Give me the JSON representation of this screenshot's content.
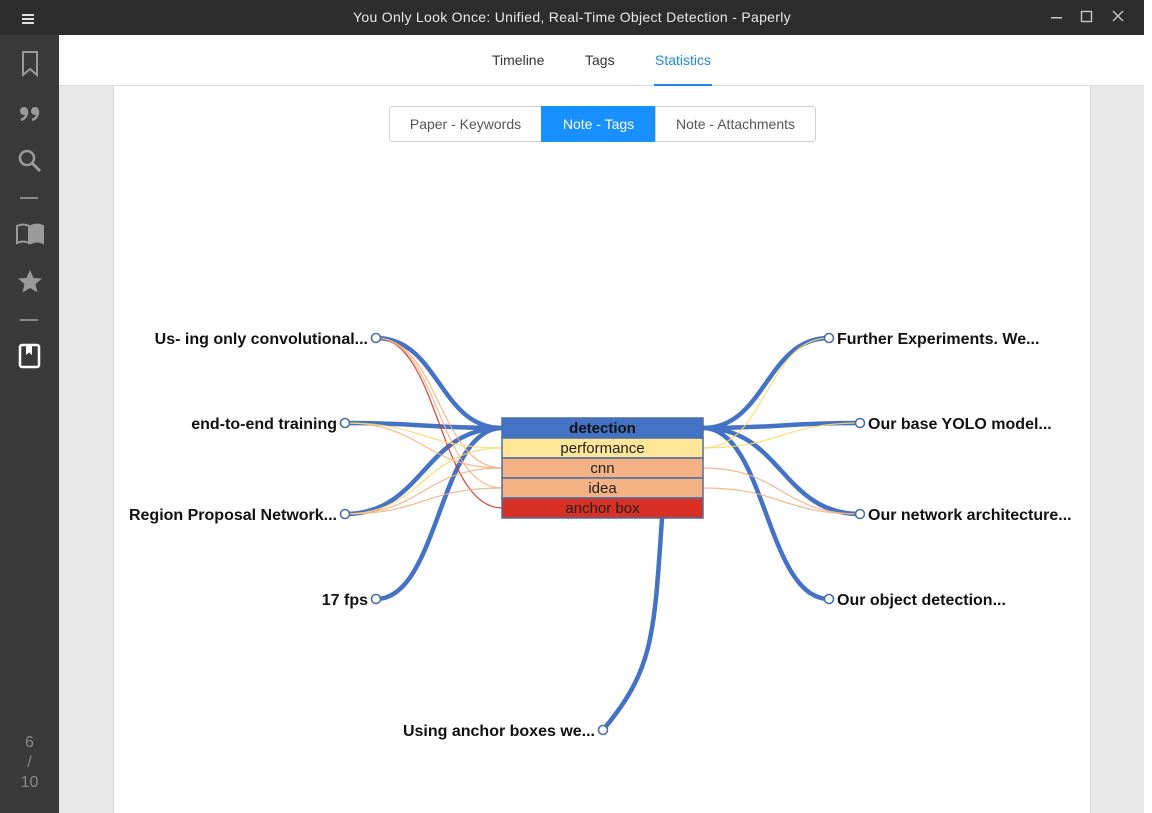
{
  "window": {
    "title": "You Only Look Once: Unified, Real-Time Object Detection - Paperly"
  },
  "sidebar": {
    "items": [
      {
        "name": "bookmark-icon"
      },
      {
        "name": "quote-icon"
      },
      {
        "name": "search-icon"
      },
      {
        "name": "book-open-icon"
      },
      {
        "name": "star-icon"
      },
      {
        "name": "note-icon"
      }
    ],
    "page_current": "6",
    "page_sep": "/",
    "page_total": "10"
  },
  "tabs": [
    {
      "label": "Timeline"
    },
    {
      "label": "Tags"
    },
    {
      "label": "Statistics",
      "active": true
    }
  ],
  "segments": [
    {
      "label": "Paper - Keywords"
    },
    {
      "label": "Note - Tags",
      "active": true
    },
    {
      "label": "Note - Attachments"
    }
  ],
  "chart_data": {
    "type": "bipartite-graph",
    "tags": [
      {
        "label": "detection",
        "color": "#4472c4"
      },
      {
        "label": "performance",
        "color": "#ffe699"
      },
      {
        "label": "cnn",
        "color": "#f4b183"
      },
      {
        "label": "idea",
        "color": "#f4b183"
      },
      {
        "label": "anchor box",
        "color": "#d93025"
      }
    ],
    "notes": [
      {
        "label": "Us- ing only convolutional...",
        "side": "left"
      },
      {
        "label": "end-to-end training",
        "side": "left"
      },
      {
        "label": "Region Proposal Network...",
        "side": "left"
      },
      {
        "label": "17 fps",
        "side": "left"
      },
      {
        "label": "Using anchor boxes we...",
        "side": "bottom"
      },
      {
        "label": "Further Experiments. We...",
        "side": "right"
      },
      {
        "label": "Our base YOLO model...",
        "side": "right"
      },
      {
        "label": "Our network architecture...",
        "side": "right"
      },
      {
        "label": "Our object detection...",
        "side": "right"
      }
    ],
    "links": [
      {
        "note": 0,
        "tag": 0
      },
      {
        "note": 1,
        "tag": 0
      },
      {
        "note": 2,
        "tag": 0
      },
      {
        "note": 3,
        "tag": 0
      },
      {
        "note": 5,
        "tag": 0
      },
      {
        "note": 6,
        "tag": 0
      },
      {
        "note": 7,
        "tag": 0
      },
      {
        "note": 8,
        "tag": 0
      },
      {
        "note": 4,
        "tag": 4
      },
      {
        "note": 0,
        "tag": 4
      },
      {
        "note": 0,
        "tag": 2
      },
      {
        "note": 0,
        "tag": 3
      },
      {
        "note": 1,
        "tag": 2
      },
      {
        "note": 1,
        "tag": 1
      },
      {
        "note": 2,
        "tag": 2
      },
      {
        "note": 2,
        "tag": 3
      },
      {
        "note": 2,
        "tag": 1
      },
      {
        "note": 5,
        "tag": 1
      },
      {
        "note": 6,
        "tag": 1
      },
      {
        "note": 7,
        "tag": 2
      },
      {
        "note": 7,
        "tag": 3
      }
    ],
    "colors": {
      "primary": "#4472c4",
      "performance": "#ffe699",
      "cnn": "#f4b183",
      "anchor": "#d93025"
    }
  }
}
